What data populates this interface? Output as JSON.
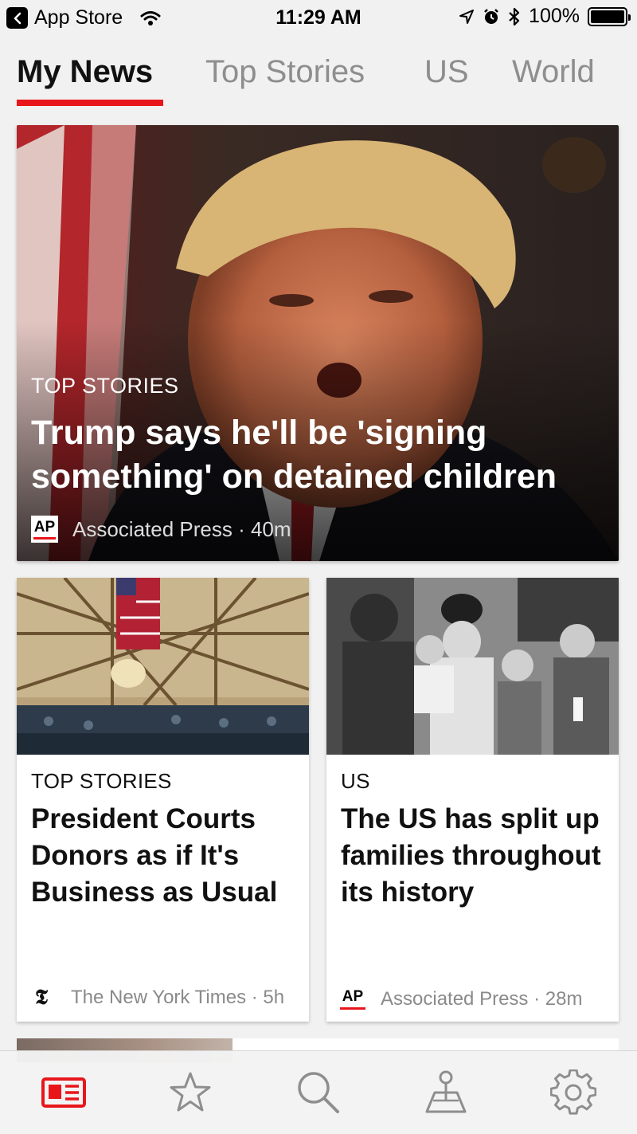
{
  "status_bar": {
    "back_app": "App Store",
    "time": "11:29 AM",
    "battery": "100%"
  },
  "tabs": [
    {
      "label": "My News",
      "active": true
    },
    {
      "label": "Top Stories",
      "active": false
    },
    {
      "label": "US",
      "active": false
    },
    {
      "label": "World",
      "active": false
    }
  ],
  "hero": {
    "category": "TOP STORIES",
    "title": "Trump says he'll be 'signing something' on detained children",
    "source_logo": "AP",
    "source": "Associated Press · 40m"
  },
  "cards": [
    {
      "category": "TOP STORIES",
      "title": "President Courts Donors as if It's Business as Usual",
      "source_logo": "𝕿",
      "source": "The New York Times · 5h"
    },
    {
      "category": "US",
      "title": "The US has split up families throughout its history",
      "source_logo": "AP",
      "source": "Associated Press · 28m"
    }
  ],
  "tab_bar": [
    {
      "icon": "news-icon",
      "active": true
    },
    {
      "icon": "star-icon",
      "active": false
    },
    {
      "icon": "search-icon",
      "active": false
    },
    {
      "icon": "map-pin-icon",
      "active": false
    },
    {
      "icon": "gear-icon",
      "active": false
    }
  ],
  "colors": {
    "accent": "#e8161b",
    "inactive_icon": "#8e8e8e"
  }
}
